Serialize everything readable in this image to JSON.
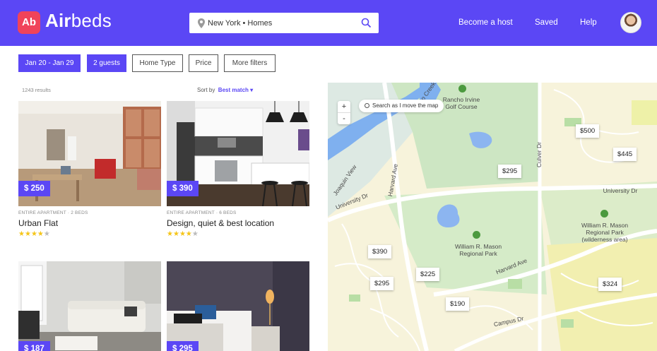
{
  "header": {
    "logo_badge": "Ab",
    "logo_bold": "Air",
    "logo_rest": "beds",
    "search_value": "New York • Homes",
    "nav": [
      "Become a host",
      "Saved",
      "Help"
    ],
    "brand_color": "#5b47f5",
    "logo_color": "#f0435a"
  },
  "filters": [
    {
      "label": "Jan 20  - Jan 29",
      "active": true
    },
    {
      "label": "2 guests",
      "active": true
    },
    {
      "label": "Home Type",
      "active": false
    },
    {
      "label": "Price",
      "active": false
    },
    {
      "label": "More filters",
      "active": false
    }
  ],
  "results": {
    "count": "1243 results",
    "sort_label": "Sort by",
    "sort_value": "Best match"
  },
  "listings": [
    {
      "price": "$ 250",
      "type": "ENTIRE APARTMENT · 2 BEDS",
      "title": "Urban Flat",
      "rating": 4
    },
    {
      "price": "$ 390",
      "type": "ENTIRE APARTMENT · 6 BEDS",
      "title": "Design, quiet & best location",
      "rating": 4
    },
    {
      "price": "$ 187",
      "type": "",
      "title": "",
      "rating": null
    },
    {
      "price": "$ 295",
      "type": "",
      "title": "",
      "rating": null
    }
  ],
  "map": {
    "search_toggle": "Search as I move the map",
    "zoom_in": "+",
    "zoom_out": "-",
    "pins": [
      "$500",
      "$445",
      "$295",
      "$390",
      "$225",
      "$295",
      "$190",
      "$324"
    ],
    "labels": {
      "golf": "Rancho Irvine\nGolf Course",
      "mason": "William R. Mason\nRegional Park",
      "mason_wild": "William R. Mason\nRegional Park\n(wilderness area)",
      "university_dr_w": "University Dr",
      "university_dr_e": "University Dr",
      "harvard_ave_n": "Harvard Ave",
      "harvard_ave_s": "Harvard Ave",
      "culver_dr": "Culver Dr",
      "campus_dr": "Campus Dr",
      "san_joaquin": "Joaquin View",
      "diego_creek": "Diego Creek"
    }
  }
}
